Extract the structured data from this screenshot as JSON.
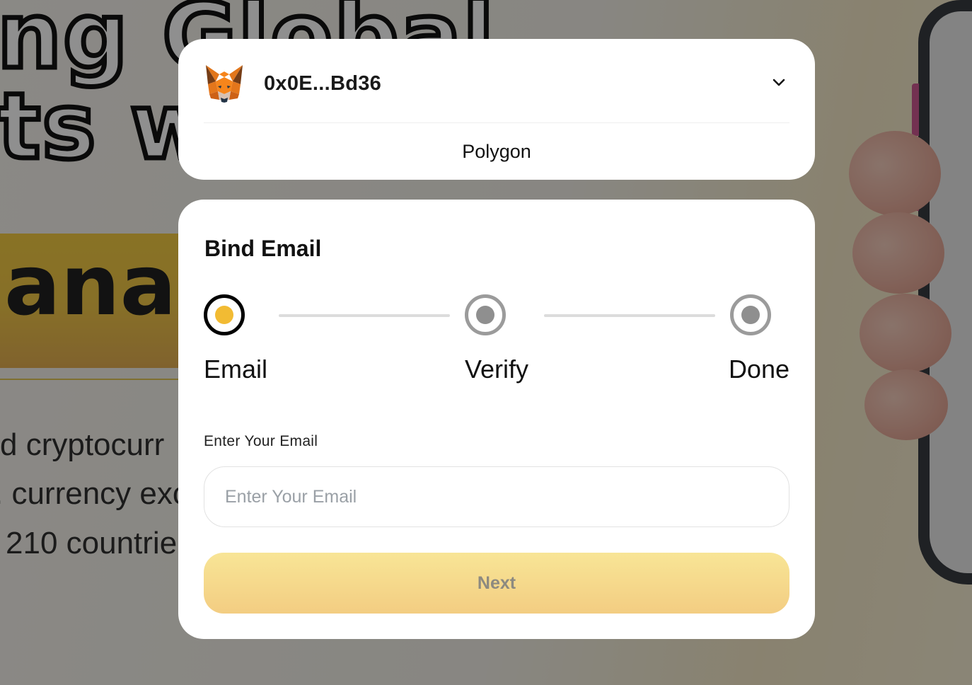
{
  "background": {
    "headline_line1": "ng Global",
    "headline_line2": "ts wi",
    "banner_text": "ana",
    "paragraph_line1": "d cryptocurr",
    "paragraph_line2": ". currency exc",
    "paragraph_line3": "210 countrie"
  },
  "wallet": {
    "icon": "metamask-fox-icon",
    "address": "0x0E...Bd36",
    "dropdown_icon": "chevron-down-icon",
    "network": "Polygon"
  },
  "bind_email": {
    "title": "Bind Email",
    "steps": [
      {
        "label": "Email",
        "state": "active"
      },
      {
        "label": "Verify",
        "state": "inactive"
      },
      {
        "label": "Done",
        "state": "inactive"
      }
    ],
    "field_label": "Enter Your Email",
    "email_value": "",
    "email_placeholder": "Enter Your Email",
    "next_label": "Next"
  },
  "colors": {
    "active_step_dot": "#f2bb33",
    "button_gradient_top": "#f8e596",
    "button_gradient_bottom": "#f3cd82",
    "overlay": "rgba(20,20,20,0.48)"
  }
}
